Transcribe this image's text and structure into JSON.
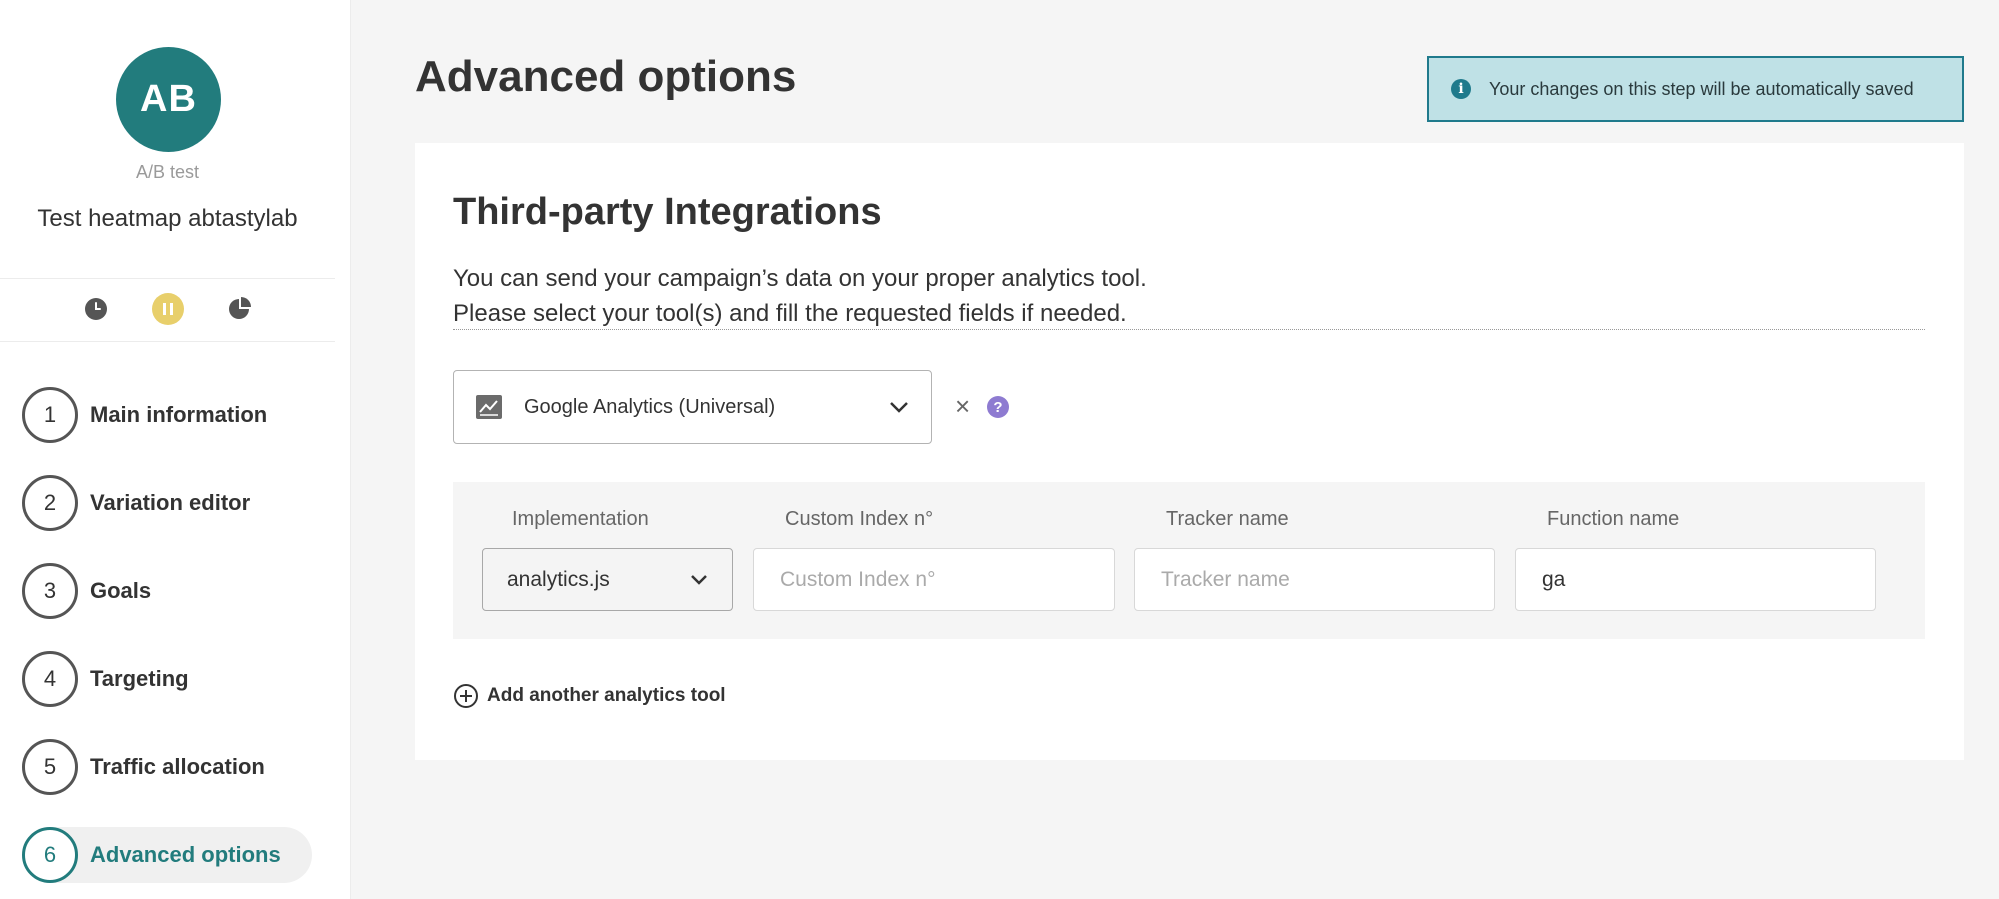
{
  "sidebar": {
    "avatar_initials": "AB",
    "campaign_type": "A/B test",
    "campaign_name": "Test heatmap abtastylab",
    "status_icons": [
      "clock-icon",
      "pause-icon",
      "pie-chart-icon"
    ],
    "steps": [
      {
        "number": "1",
        "label": "Main information"
      },
      {
        "number": "2",
        "label": "Variation editor"
      },
      {
        "number": "3",
        "label": "Goals"
      },
      {
        "number": "4",
        "label": "Targeting"
      },
      {
        "number": "5",
        "label": "Traffic allocation"
      },
      {
        "number": "6",
        "label": "Advanced options"
      }
    ],
    "active_step": "6"
  },
  "header": {
    "title": "Advanced options",
    "notice": "Your changes on this step will be automatically saved"
  },
  "integrations": {
    "title": "Third-party Integrations",
    "description_line1": "You can send your campaign’s data on your proper analytics tool.",
    "description_line2": "Please select your tool(s) and fill the requested fields if needed.",
    "selected_tool": "Google Analytics (Universal)",
    "fields": {
      "implementation_label": "Implementation",
      "implementation_value": "analytics.js",
      "custom_index_label": "Custom Index n°",
      "custom_index_placeholder": "Custom Index n°",
      "tracker_name_label": "Tracker name",
      "tracker_name_placeholder": "Tracker name",
      "function_name_label": "Function name",
      "function_name_value": "ga"
    },
    "add_tool_label": "Add another analytics tool"
  },
  "colors": {
    "brand_teal": "#227c7d",
    "notice_bg": "#bfe1e6",
    "notice_border": "#1f7a8c",
    "pause_yellow": "#e8cf6b",
    "help_purple": "#8e7bd1"
  }
}
